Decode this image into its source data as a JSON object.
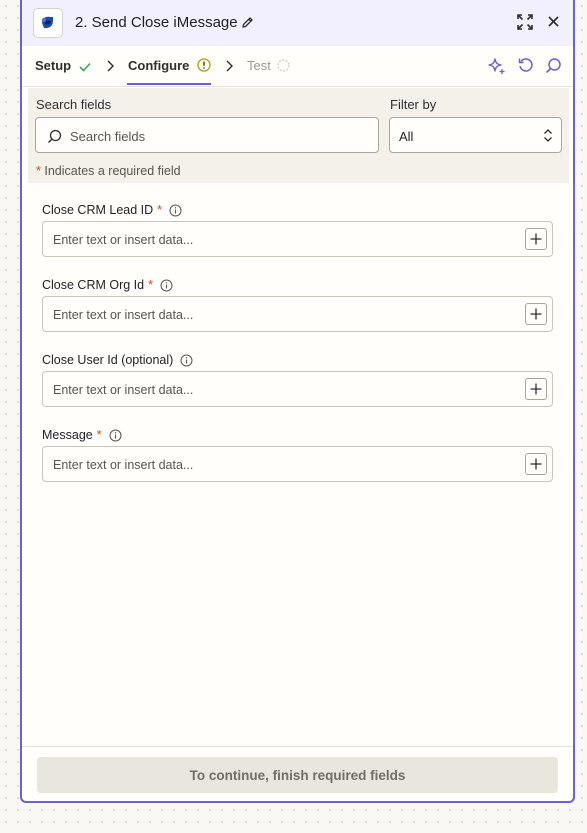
{
  "header": {
    "title": "2. Send Close iMessage",
    "app_icon": "close-crm-logo",
    "icons": [
      "edit-icon",
      "expand-icon",
      "close-icon"
    ]
  },
  "tabs": [
    {
      "label": "Setup",
      "status": "complete"
    },
    {
      "label": "Configure",
      "status": "warning",
      "active": true
    },
    {
      "label": "Test",
      "status": "pending"
    }
  ],
  "toolbar": {
    "icons": [
      "ai-sparkle-icon",
      "refresh-icon",
      "search-icon"
    ]
  },
  "search": {
    "label": "Search fields",
    "placeholder": "Search fields",
    "filter_label": "Filter by",
    "filter_value": "All"
  },
  "required_note": {
    "star": "*",
    "text": "Indicates a required field"
  },
  "fields": [
    {
      "label": "Close CRM Lead ID",
      "required": "*",
      "placeholder": "Enter text or insert data..."
    },
    {
      "label": "Close CRM Org Id",
      "required": "*",
      "placeholder": "Enter text or insert data..."
    },
    {
      "label": "Close User Id (optional)",
      "required": "",
      "placeholder": "Enter text or insert data..."
    },
    {
      "label": "Message",
      "required": "*",
      "placeholder": "Enter text or insert data..."
    }
  ],
  "footer": {
    "button_label": "To continue, finish required fields"
  },
  "colors": {
    "accent": "#6b5fd3",
    "required": "#d8451b",
    "success": "#3aa757",
    "warning": "#b59a0b"
  }
}
